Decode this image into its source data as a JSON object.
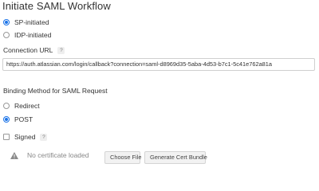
{
  "title": "Initiate SAML Workflow",
  "initiation": {
    "options": [
      {
        "label": "SP-initiated",
        "checked": true
      },
      {
        "label": "IDP-initiated",
        "checked": false
      }
    ]
  },
  "connection_url": {
    "label": "Connection URL",
    "help": "?",
    "value": "https://auth.atlassian.com/login/callback?connection=saml-d8969d35-5aba-4d53-b7c1-5c41e762a81a"
  },
  "binding": {
    "label": "Binding Method for SAML Request",
    "options": [
      {
        "label": "Redirect",
        "checked": false
      },
      {
        "label": "POST",
        "checked": true
      }
    ]
  },
  "signed": {
    "label": "Signed",
    "help": "?",
    "checked": false
  },
  "certificate": {
    "status": "No certificate loaded",
    "choose_file_label": "Choose File",
    "generate_label": "Generate Cert Bundle"
  },
  "colors": {
    "accent": "#1a73e8",
    "warning_icon": "#8a8a8a"
  }
}
